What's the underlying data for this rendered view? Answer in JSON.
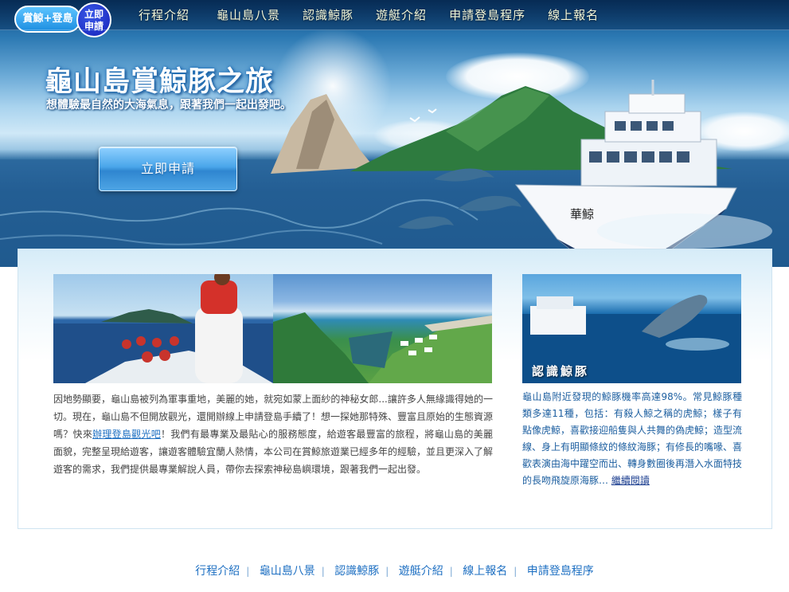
{
  "logo": {
    "pill_text": "賞鯨+登島",
    "circle_line1": "立即",
    "circle_line2": "申請"
  },
  "nav": [
    "行程介紹",
    "龜山島八景",
    "認識鯨豚",
    "遊艇介紹",
    "申請登島程序",
    "線上報名"
  ],
  "hero": {
    "title": "龜山島賞鯨豚之旅",
    "subtitle": "想體驗最自然的大海氣息，跟著我們一起出發吧。",
    "apply_button": "立即申請",
    "boat_name": "華鯨"
  },
  "main": {
    "para_1": "因地勢顯要，龜山島被列為軍事重地，美麗的她，就宛如蒙上面紗的神秘女郎...讓許多人無緣識得她的一切。現在，龜山島不但開放觀光，還開辦線上申請登島手續了！想一探她那特殊、豐富且原始的生態資源嗎？快來",
    "link": "辦理登島觀光吧",
    "para_2": "！我們有最專業及最貼心的服務態度，給遊客最豐富的旅程，將龜山島的美麗面貌，完整呈現給遊客，讓遊客體驗宜蘭人熱情，本公司在賞鯨旅遊業已經多年的經驗，並且更深入了解遊客的需求，我們提供最專業解說人員，帶你去探索神秘島嶼環境，跟著我們一起出發。"
  },
  "side": {
    "caption": "認識鯨豚",
    "text": "龜山島附近發現的鯨豚機率高達98%。常見鯨豚種類多達11種，包括：有殺人鯨之稱的虎鯨；樣子有點像虎鯨，喜歡接迎船隻與人共舞的偽虎鯨；造型流線、身上有明顯條紋的條紋海豚；有修長的嘴喙、喜歡表演由海中躍空而出、轉身數圈後再潛入水面特技的長吻飛旋原海豚…",
    "more": "繼續閱讀"
  },
  "footer_nav": [
    "行程介紹",
    "龜山島八景",
    "認識鯨豚",
    "遊艇介紹",
    "線上報名",
    "申請登島程序"
  ]
}
